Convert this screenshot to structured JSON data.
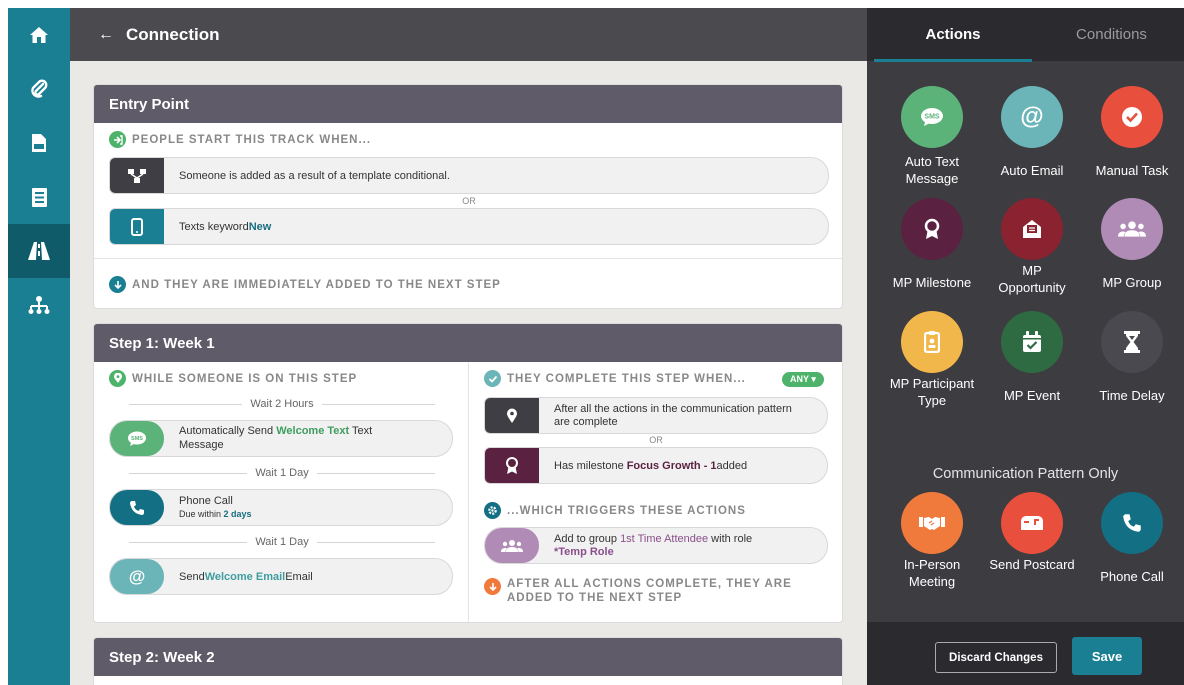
{
  "nav": {
    "items": [
      {
        "icon": "home-icon"
      },
      {
        "icon": "paperclip-icon"
      },
      {
        "icon": "csv-file-icon"
      },
      {
        "icon": "form-icon"
      },
      {
        "icon": "road-icon"
      },
      {
        "icon": "org-chart-icon"
      }
    ],
    "active_index": 4
  },
  "header": {
    "back": "←",
    "title": "Connection"
  },
  "entry": {
    "title": "Entry Point",
    "start_heading": "PEOPLE START THIS TRACK WHEN...",
    "trigger1": "Someone is added as a result of a template conditional.",
    "or": "OR",
    "trigger2_prefix": "Texts keyword ",
    "trigger2_keyword": "New",
    "added_heading": "AND THEY ARE IMMEDIATELY ADDED TO THE NEXT STEP"
  },
  "step1": {
    "title": "Step 1: Week 1",
    "while_heading": "WHILE SOMEONE IS ON THIS STEP",
    "wait1": "Wait 2 Hours",
    "action1_prefix": "Automatically Send ",
    "action1_name": "Welcome Text",
    "action1_suffix": " Text",
    "action1_line2": "Message",
    "wait2": "Wait 1 Day",
    "action2_line1": "Phone Call",
    "action2_due_prefix": "Due within ",
    "action2_due_value": "2 days",
    "wait3": "Wait 1 Day",
    "action3_prefix": "Send ",
    "action3_name": "Welcome Email",
    "action3_suffix": " Email",
    "complete_heading": "THEY COMPLETE THIS STEP WHEN...",
    "any_badge": "ANY ▾",
    "cond1_line1": "After all the actions in the communication pattern",
    "cond1_line2": "are complete",
    "or": "OR",
    "cond2_prefix": "Has milestone ",
    "cond2_name": "Focus Growth - 1",
    "cond2_suffix": " added",
    "triggers_heading": "...WHICH TRIGGERS THESE ACTIONS",
    "trig1_prefix": "Add to group ",
    "trig1_group": "1st Time Attendee",
    "trig1_mid": " with role",
    "trig1_role": "*Temp Role",
    "after_heading_line1": "AFTER ALL ACTIONS COMPLETE, THEY ARE",
    "after_heading_line2": "ADDED TO THE NEXT STEP"
  },
  "step2": {
    "title": "Step 2: Week 2"
  },
  "panel": {
    "tab_actions": "Actions",
    "tab_conditions": "Conditions",
    "actions": [
      {
        "label": "Auto Text Message",
        "icon": "sms-icon",
        "color": "#5bb37a"
      },
      {
        "label": "Auto Email",
        "icon": "at-icon",
        "color": "#6bb5b8"
      },
      {
        "label": "Manual Task",
        "icon": "checkmark-icon",
        "color": "#e84f3d"
      },
      {
        "label": "MP Milestone",
        "icon": "award-icon",
        "color": "#5a2240"
      },
      {
        "label": "MP Opportunity",
        "icon": "envelope-open-icon",
        "color": "#8b2230"
      },
      {
        "label": "MP Group",
        "icon": "group-icon",
        "color": "#b08bb5"
      },
      {
        "label": "MP Participant Type",
        "icon": "badge-icon",
        "color": "#f2b74b"
      },
      {
        "label": "MP Event",
        "icon": "calendar-check-icon",
        "color": "#2e6b42"
      },
      {
        "label": "Time Delay",
        "icon": "hourglass-icon",
        "color": "#4a4950"
      }
    ],
    "cp_title": "Communication Pattern Only",
    "cp_actions": [
      {
        "label": "In-Person Meeting",
        "icon": "handshake-icon",
        "color": "#f07a3c"
      },
      {
        "label": "Send Postcard",
        "icon": "mailbox-icon",
        "color": "#e84f3d"
      },
      {
        "label": "Phone Call",
        "icon": "phone-icon",
        "color": "#136f84"
      }
    ],
    "discard": "Discard Changes",
    "save": "Save"
  }
}
